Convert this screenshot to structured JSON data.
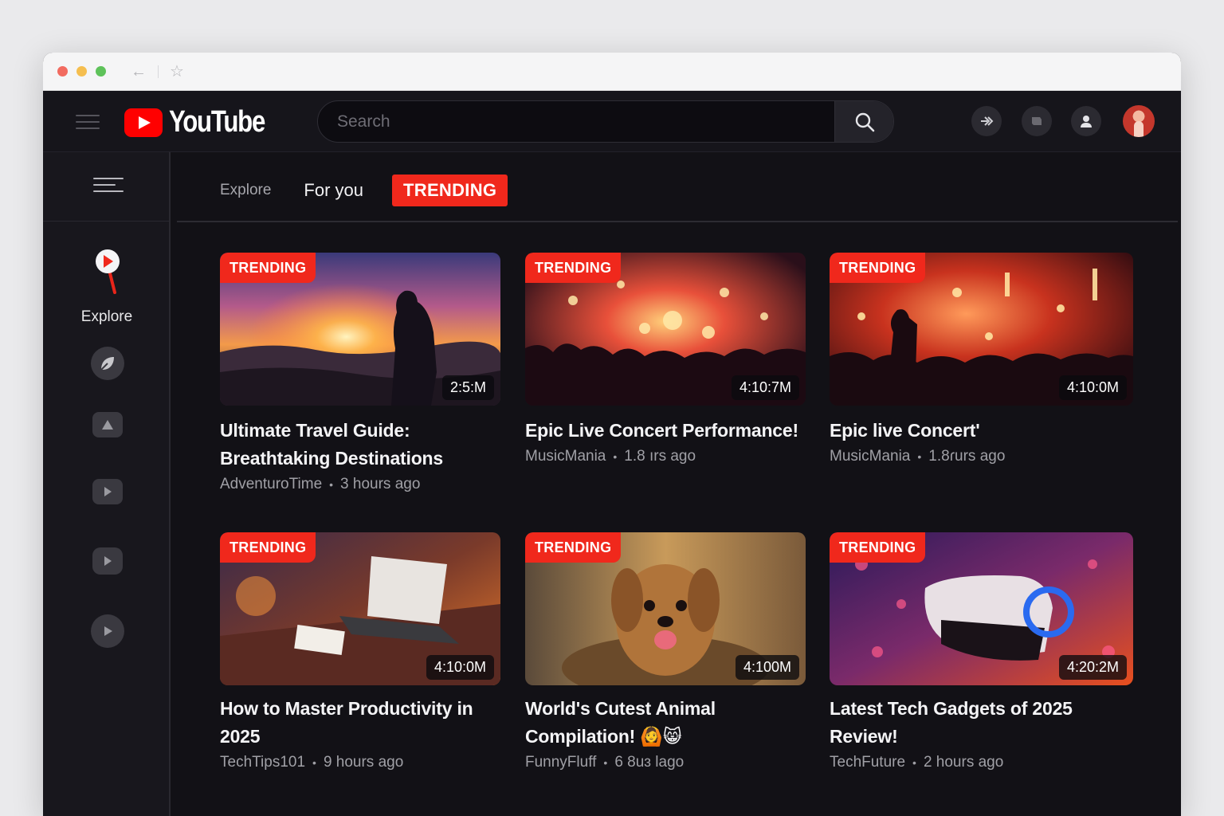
{
  "app": {
    "logo_text": "YouTube",
    "search_placeholder": "Search"
  },
  "header_icons": [
    "chevron-forward-icon",
    "chat-icon",
    "account-icon"
  ],
  "sidebar": {
    "explore_label": "Explore",
    "buttons": [
      "leaf-icon",
      "upload-icon",
      "play-icon",
      "play-icon",
      "play-circle-icon"
    ]
  },
  "tabs": {
    "explore": "Explore",
    "for_you": "For you",
    "trending": "TRENDING"
  },
  "videos": [
    {
      "badge": "TRENDING",
      "duration": "2:5:M",
      "title": "Ultimate Travel Guide: Breathtaking Destinations",
      "channel": "AdventuroTime",
      "age": "3 hours ago"
    },
    {
      "badge": "TRENDING",
      "duration": "4:10:7M",
      "title": "Epic Live Concert Performance!",
      "channel": "MusicMania",
      "age": "1.8 ırs ago"
    },
    {
      "badge": "TRENDING",
      "duration": "4:10:0M",
      "title": "Epic live Concert'",
      "channel": "MusicMania",
      "age": "1.8ɾurs ago"
    },
    {
      "badge": "TRENDING",
      "duration": "4:10:0M",
      "title": "How to Master Productivity in 2025",
      "channel": "TechTips101",
      "age": "9 hours ago"
    },
    {
      "badge": "TRENDING",
      "duration": "4:100M",
      "title": "World's Cutest Animal Compilation! 🙆😸",
      "channel": "FunnyFluff",
      "age": "6 8uɜ lago"
    },
    {
      "badge": "TRENDING",
      "duration": "4:20:2M",
      "title": "Latest Tech Gadgets of 2025 Review!",
      "channel": "TechFuture",
      "age": "2 hours ago"
    }
  ],
  "colors": {
    "accent_red": "#f0281c",
    "background": "#121116",
    "topbar": "#16151b",
    "sidebar": "#18171d"
  }
}
